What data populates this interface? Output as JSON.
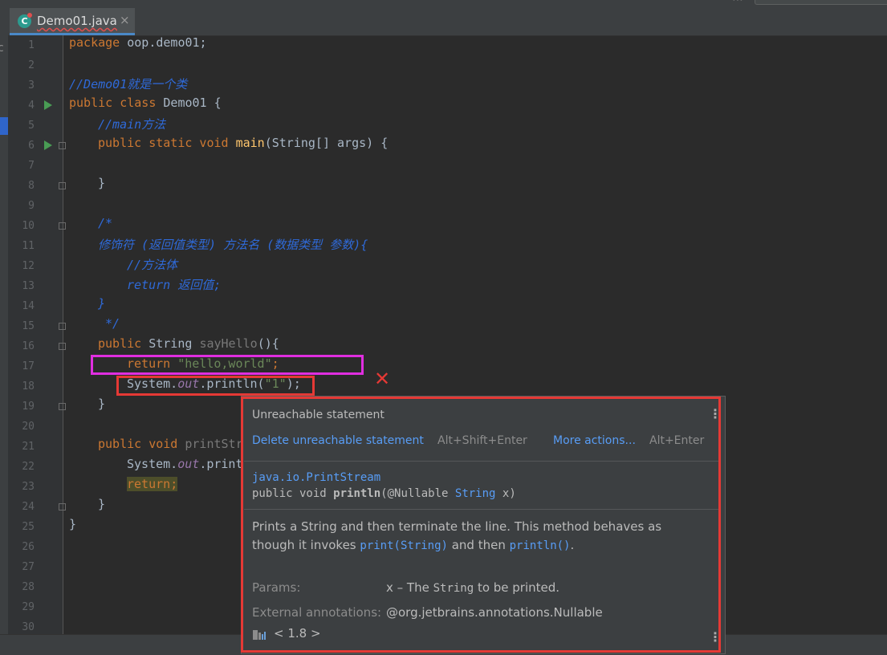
{
  "tab": {
    "title": "Demo01.java",
    "close": "×"
  },
  "leftstrip_letter": "c",
  "line_numbers": [
    "1",
    "2",
    "3",
    "4",
    "5",
    "6",
    "7",
    "8",
    "9",
    "10",
    "11",
    "12",
    "13",
    "14",
    "15",
    "16",
    "17",
    "18",
    "19",
    "20",
    "21",
    "22",
    "23",
    "24",
    "25",
    "26",
    "27",
    "28",
    "29",
    "30"
  ],
  "code": {
    "l1a": "package",
    "l1b": " oop.demo01;",
    "l3": "//Demo01就是一个类",
    "l4a": "public class",
    "l4b": " Demo01 {",
    "l5": "//main方法",
    "l6a": "public static void",
    "l6b": "main",
    "l6c": "(String[] args) {",
    "l8": "}",
    "l10": "/*",
    "l11": "修饰符 (返回值类型) 方法名 (数据类型 参数){",
    "l12": "//方法体",
    "l13": "return 返回值;",
    "l14": "}",
    "l15": " */",
    "l16a": "public",
    "l16b": " String ",
    "l16c": "sayHello",
    "l16d": "(){",
    "l17a": "return",
    "l17b": "\"hello,world\"",
    "l17c": ";",
    "l18a": "System.",
    "l18b": "out",
    "l18c": ".println(",
    "l18d": "\"1\"",
    "l18e": ");",
    "l19": "}",
    "l21a": "public void",
    "l21b": "printStr",
    "l22a": "System.",
    "l22b": "out",
    "l22c": ".print",
    "l23a": "return",
    "l23b": ";",
    "l24": "}",
    "l25": "}"
  },
  "annotation_mark": "✕",
  "popup": {
    "title": "Unreachable statement",
    "action1": "Delete unreachable statement",
    "action1_key": "Alt+Shift+Enter",
    "action2": "More actions...",
    "action2_key": "Alt+Enter",
    "sig_class": "java.io.PrintStream",
    "sig_a": "public void ",
    "sig_b": "println",
    "sig_c": "(@Nullable ",
    "sig_d": "String",
    "sig_e": " x)",
    "desc_a": "Prints a String and then terminate the line. This method behaves as though it invokes ",
    "desc_b": "print(String)",
    "desc_c": " and then ",
    "desc_d": "println()",
    "desc_e": ".",
    "params_label": "Params:",
    "params_a": "x – The ",
    "params_b": "String",
    "params_c": " to be printed.",
    "ext_label": "External annotations:",
    "ext_value": "@org.jetbrains.annotations.Nullable",
    "jdk": "< 1.8 >",
    "menu_icon": "⋮"
  },
  "colors": {
    "keyword": "#cc7832",
    "comment": "#2f6ad9",
    "string": "#6a8759",
    "link": "#589df6",
    "annotation_box": "#e53935",
    "highlight_box": "#e02ee0"
  }
}
